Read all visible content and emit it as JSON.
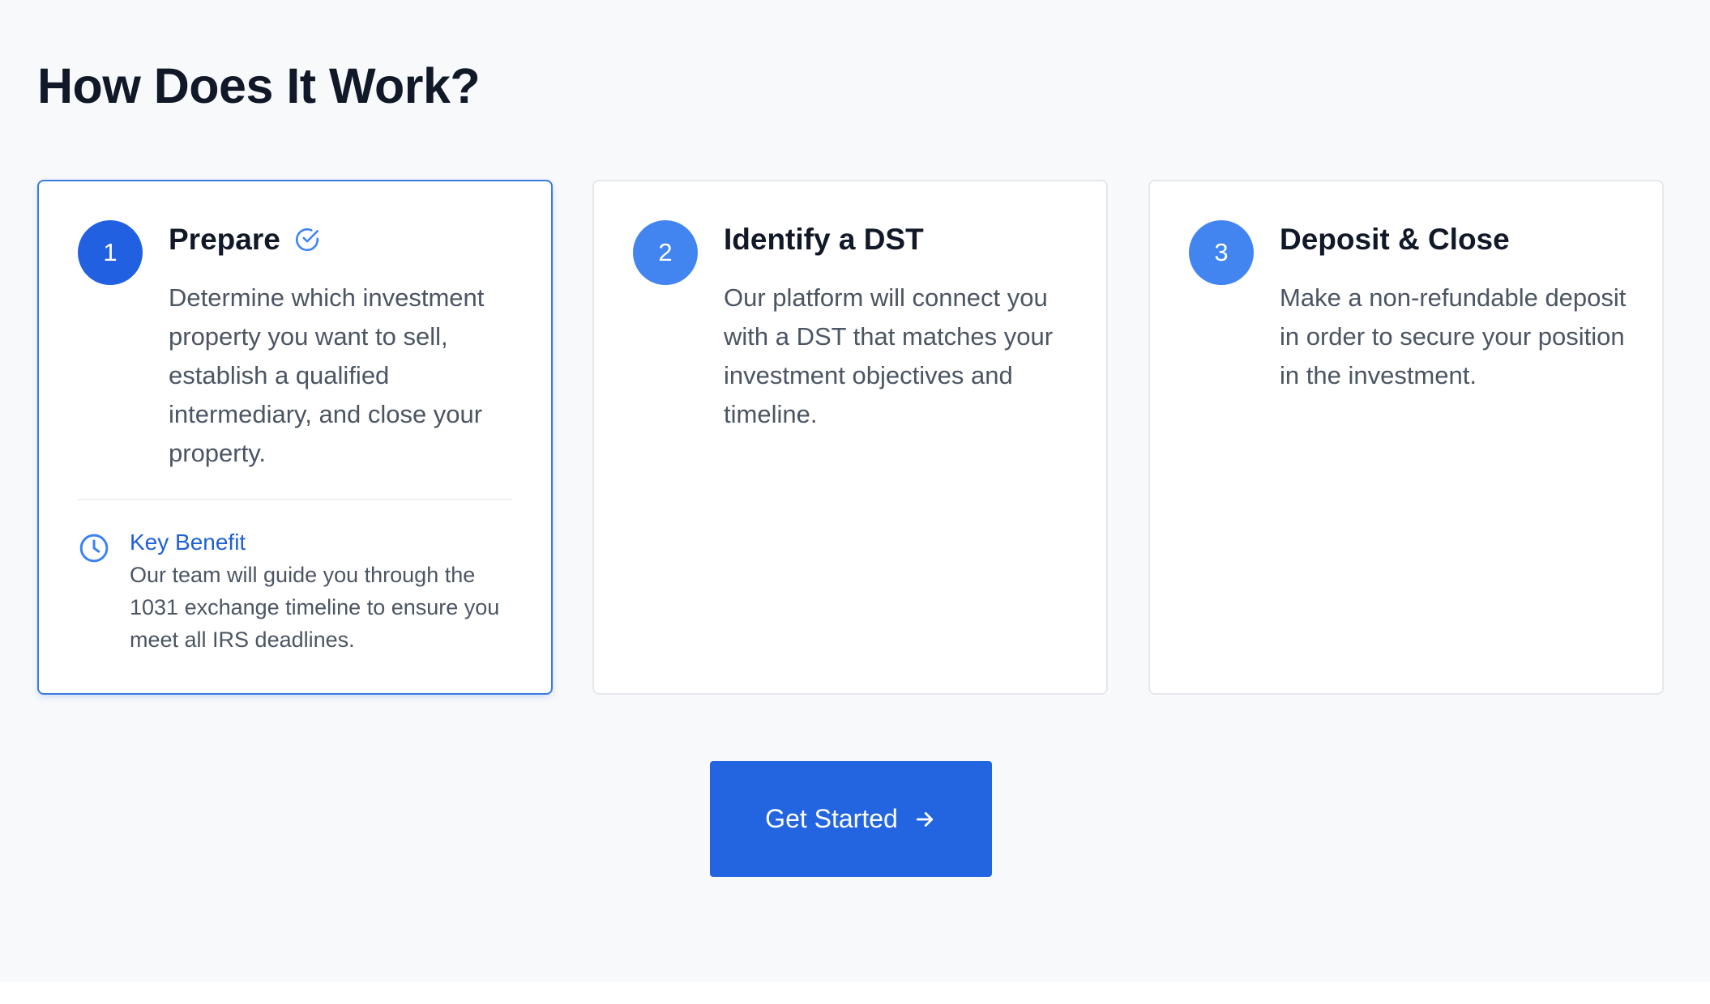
{
  "section": {
    "title": "How Does It Work?"
  },
  "steps": [
    {
      "number": "1",
      "title": "Prepare",
      "description": "Determine which investment property you want to sell, establish a qualified intermediary, and close your property.",
      "active": true,
      "status_icon": "check-circle-icon",
      "benefit": {
        "icon": "clock-icon",
        "title": "Key Benefit",
        "text": "Our team will guide you through the 1031 exchange timeline to ensure you meet all IRS deadlines."
      }
    },
    {
      "number": "2",
      "title": "Identify a DST",
      "description": "Our platform will connect you with a DST that matches your investment objectives and timeline.",
      "active": false
    },
    {
      "number": "3",
      "title": "Deposit & Close",
      "description": "Make a non-refundable deposit in order to secure your position in the investment.",
      "active": false
    }
  ],
  "cta": {
    "label": "Get Started",
    "icon": "arrow-right-icon"
  },
  "colors": {
    "accent": "#2365e0",
    "badge_active": "#2160e0",
    "badge_inactive": "#4285f0",
    "card_active_border": "#3b7be0",
    "background": "#f8f9fb",
    "heading": "#111827",
    "body_text": "#4b5563",
    "benefit_title": "#1f5fd6"
  }
}
